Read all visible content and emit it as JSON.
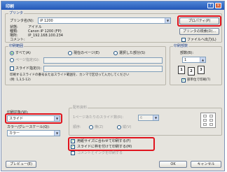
{
  "window": {
    "title": "印刷",
    "help_label": "?",
    "close_label": "×"
  },
  "printer": {
    "group_label": "プリンタ",
    "name_label": "プリンタ名(N):",
    "name_value": "iP 1200",
    "properties_button": "プロパティ(P)",
    "find_button": "プリンタの検索(D)...",
    "status_label": "状態:",
    "status_value": "アイドル",
    "type_label": "種類:",
    "type_value": "Canon iP 1200 (FP)",
    "where_label": "場所:",
    "where_value": "IP_192.168.100.234",
    "comment_label": "コメント:",
    "print_to_file_label": "ファイルへ出力(L)"
  },
  "range": {
    "group_label": "印刷範囲",
    "all_label": "すべて(A)",
    "current_page_label": "現在のページ(E)",
    "selection_label": "選択した部分(S)",
    "pages_label": "ページ指定(G):",
    "slide_label": "スライド指定(I):",
    "hint_line1": "印刷するスライドの番号またはスライド範囲を、カンマで区切って入力してください",
    "hint_line2": "(例: 1,3,5-12)"
  },
  "copies": {
    "group_label": "印刷部数",
    "count_label": "部数(B):",
    "count_value": "1",
    "collate_label": "部単位で印刷(T)",
    "page_labels": [
      "1",
      "2",
      "3"
    ]
  },
  "print_what": {
    "label": "印刷対象(W):",
    "value": "スライド"
  },
  "color": {
    "label": "カラー/グレースケール(Q):",
    "value": "カラー"
  },
  "handouts": {
    "group_label": "配布資料",
    "per_page_label": "1ページあたりのスライド数(R):",
    "per_page_value": "6",
    "order_label": "順序:",
    "horizontal_label": "横(Z)",
    "vertical_label": "縦(V)"
  },
  "options": {
    "fit_label": "用紙サイズに合わせて印刷する(F)",
    "frame_label": "スライドに枠を付けて印刷する(M)",
    "comments_label": "コメントとインクを印刷する"
  },
  "footer": {
    "preview_button": "プレビュー(E)",
    "ok_button": "OK",
    "cancel_button": "キャンセル"
  },
  "colors": {
    "highlight": "#e0141e",
    "title_bar": "#2457b7",
    "dialog_bg": "#e6e4de"
  }
}
